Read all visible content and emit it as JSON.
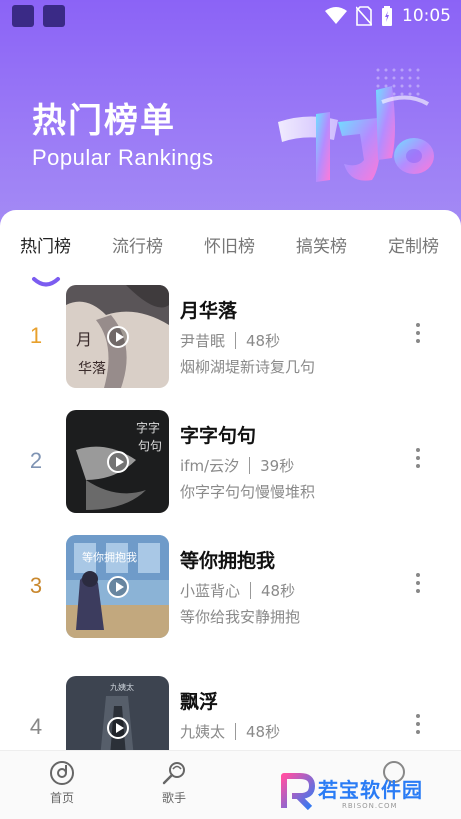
{
  "status_bar": {
    "time": "10:05"
  },
  "header": {
    "title_cn": "热门榜单",
    "title_en": "Popular Rankings"
  },
  "tabs": [
    {
      "label": "热门榜",
      "active": true
    },
    {
      "label": "流行榜",
      "active": false
    },
    {
      "label": "怀旧榜",
      "active": false
    },
    {
      "label": "搞笑榜",
      "active": false
    },
    {
      "label": "定制榜",
      "active": false
    }
  ],
  "songs": [
    {
      "rank": "1",
      "rank_color": "#e8a02c",
      "title": "月华落",
      "artist": "尹昔眠",
      "duration": "48秒",
      "lyric": "烟柳湖堤新诗复几句"
    },
    {
      "rank": "2",
      "rank_color": "#7e93b3",
      "title": "字字句句",
      "artist": "ifm/云汐",
      "duration": "39秒",
      "lyric": "你字字句句慢慢堆积"
    },
    {
      "rank": "3",
      "rank_color": "#c9882e",
      "title": "等你拥抱我",
      "artist": "小蓝背心",
      "duration": "48秒",
      "lyric": "等你给我安静拥抱"
    },
    {
      "rank": "4",
      "rank_color": "#888888",
      "title": "飘浮",
      "artist": "九姨太",
      "duration": "48秒",
      "lyric": ""
    }
  ],
  "bottom_nav": [
    {
      "label": "首页",
      "icon": "disc-icon"
    },
    {
      "label": "歌手",
      "icon": "singer-icon"
    }
  ],
  "watermark": {
    "text": "若宝软件园",
    "sub": "RBISON.COM"
  },
  "colors": {
    "header_top": "#8b63f6",
    "accent": "#7b5cf0",
    "watermark_blue": "#2a7cf5"
  }
}
